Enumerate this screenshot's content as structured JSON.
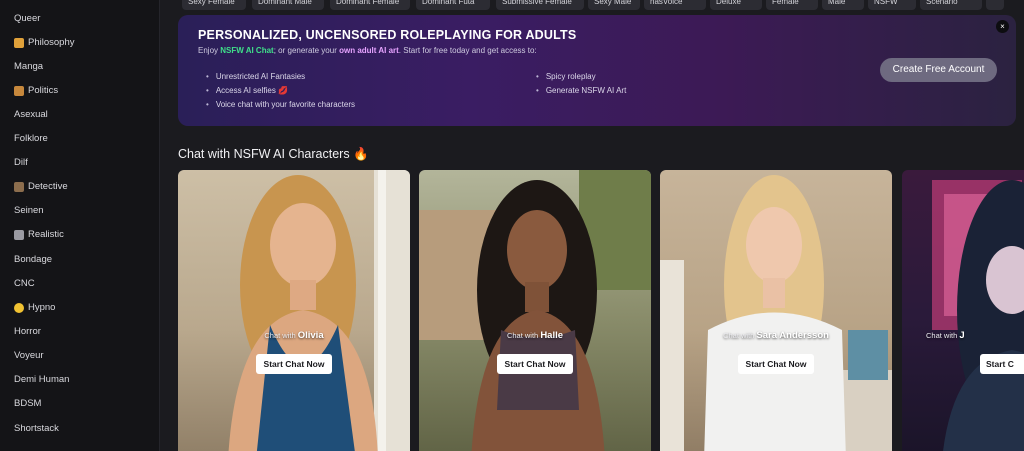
{
  "sidebar": {
    "items": [
      {
        "label": "Queer",
        "icon": ""
      },
      {
        "label": "Philosophy",
        "icon": "book-icon"
      },
      {
        "label": "Manga",
        "icon": ""
      },
      {
        "label": "Politics",
        "icon": "ballot-icon"
      },
      {
        "label": "Asexual",
        "icon": ""
      },
      {
        "label": "Folklore",
        "icon": ""
      },
      {
        "label": "Dilf",
        "icon": ""
      },
      {
        "label": "Detective",
        "icon": "detective-icon"
      },
      {
        "label": "Seinen",
        "icon": ""
      },
      {
        "label": "Realistic",
        "icon": "camera-icon"
      },
      {
        "label": "Bondage",
        "icon": ""
      },
      {
        "label": "CNC",
        "icon": ""
      },
      {
        "label": "Hypno",
        "icon": "dizzy-face-icon"
      },
      {
        "label": "Horror",
        "icon": ""
      },
      {
        "label": "Voyeur",
        "icon": ""
      },
      {
        "label": "Demi Human",
        "icon": ""
      },
      {
        "label": "BDSM",
        "icon": ""
      },
      {
        "label": "Shortstack",
        "icon": ""
      }
    ]
  },
  "tags": [
    "Sexy Female",
    "Dominant Male",
    "Dominant Female",
    "Dominant Futa",
    "Submissive Female",
    "Sexy Male",
    "hasVoice",
    "Deluxe",
    "Female",
    "Male",
    "NSFW",
    "Scenario"
  ],
  "banner": {
    "title": "PERSONALIZED, UNCENSORED ROLEPLAYING FOR ADULTS",
    "sub_pre": "Enjoy ",
    "sub_link1": "NSFW AI Chat",
    "sub_mid": "; or generate your ",
    "sub_link2": "own adult AI art",
    "sub_post": ". Start for free today and get access to:",
    "features_left": [
      "Unrestricted AI Fantasies",
      "Access AI selfies 💋",
      "Voice chat with your favorite characters"
    ],
    "features_right": [
      "Spicy roleplay",
      "Generate NSFW AI Art"
    ],
    "cta": "Create Free Account",
    "close": "×"
  },
  "section": {
    "title": "Chat with NSFW AI Characters 🔥"
  },
  "cards": [
    {
      "prefix": "Chat with ",
      "name": "Olivia",
      "button": "Start Chat Now"
    },
    {
      "prefix": "Chat with ",
      "name": "Halle",
      "button": "Start Chat Now"
    },
    {
      "prefix": "Chat with ",
      "name": "Sara Andersson",
      "button": "Start Chat Now"
    },
    {
      "prefix": "Chat with ",
      "name": "J",
      "button": "Start C"
    }
  ],
  "colors": {
    "accent_green": "#3fe08a",
    "accent_pink": "#e6a3ff",
    "banner_start": "#2a1f58",
    "banner_end": "#2b2240"
  }
}
